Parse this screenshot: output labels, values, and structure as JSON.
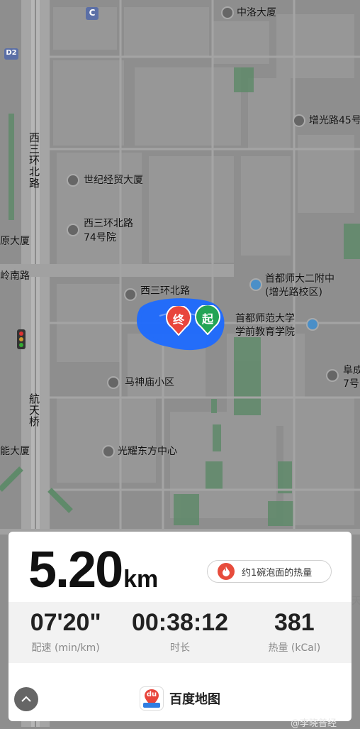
{
  "map": {
    "pois": [
      {
        "name": "中洛大厦"
      },
      {
        "name": "增光路45号"
      },
      {
        "name": "世纪经贸大厦"
      },
      {
        "name_line1": "西三环北路",
        "name_line2": "74号院"
      },
      {
        "name": "原大厦"
      },
      {
        "name": "岭南路"
      },
      {
        "name_line1": "首都师大二附中",
        "name_line2": "(增光路校区)"
      },
      {
        "name": "西三环北路"
      },
      {
        "name_line1": "首都师范大学",
        "name_line2": "学前教育学院"
      },
      {
        "name": "马神庙小区"
      },
      {
        "name": "光耀东方中心"
      },
      {
        "name": "能大厦"
      },
      {
        "name_line1": "阜成",
        "name_line2": "7号"
      },
      {
        "name": "天"
      }
    ],
    "road_labels": {
      "xisanhuan": "西三环北路",
      "hangtianqiao": "航天桥"
    },
    "road_badges": {
      "c": "C",
      "d2": "D2"
    },
    "markers": {
      "end": "终",
      "start": "起",
      "end_color": "#e8453c",
      "start_color": "#23a455"
    },
    "route_color": "#1e6bff"
  },
  "summary": {
    "distance_value": "5.20",
    "distance_unit": "km",
    "calorie_equivalent": "约1碗泡面的热量",
    "stats": [
      {
        "value": "07'20\"",
        "label": "配速 (min/km)"
      },
      {
        "value": "00:38:12",
        "label": "时长"
      },
      {
        "value": "381",
        "label": "热量 (kCal)"
      }
    ]
  },
  "brand": {
    "logo_text": "du",
    "name": "百度地图"
  },
  "controls": {
    "collapse_icon": "chevron-up-icon"
  },
  "watermark": "@李晓普经"
}
